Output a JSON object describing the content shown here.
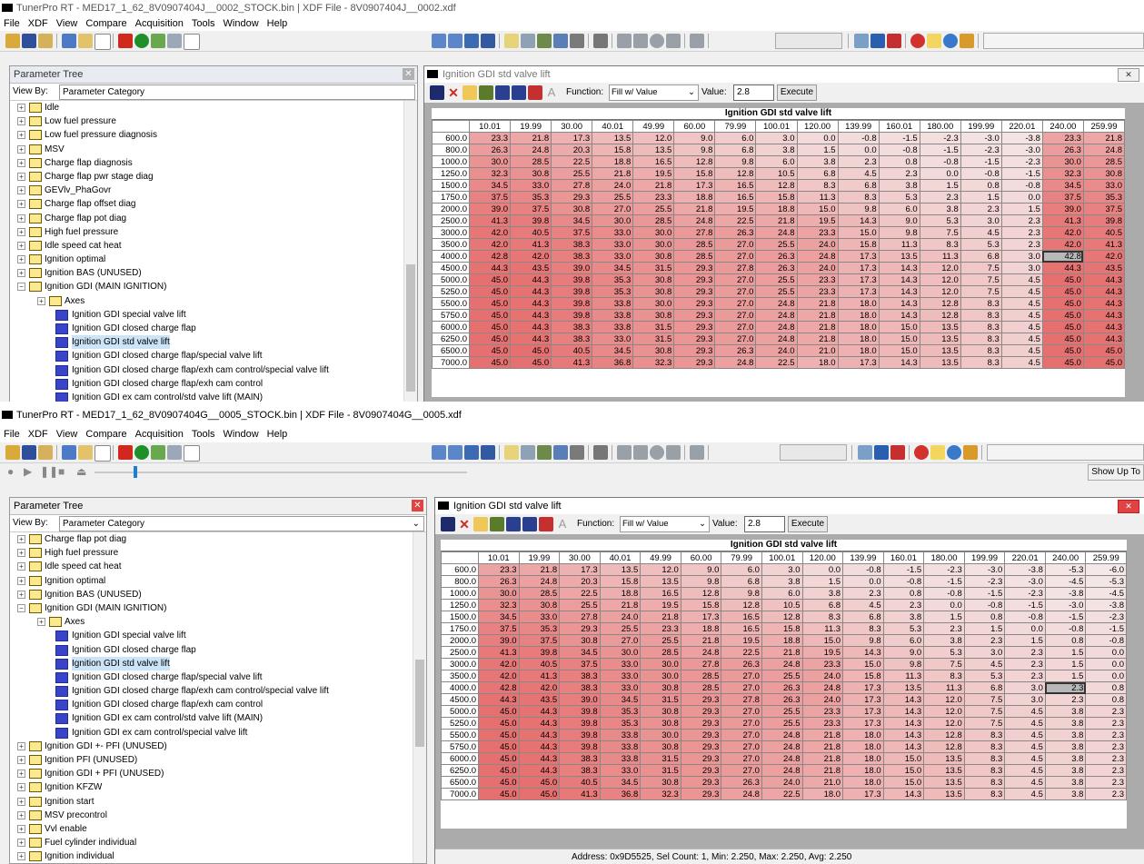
{
  "top": {
    "title": "TunerPro RT - MED17_1_62_8V0907404J__0002_STOCK.bin | XDF File - 8V0907404J__0002.xdf",
    "menu": [
      "File",
      "XDF",
      "View",
      "Compare",
      "Acquisition",
      "Tools",
      "Window",
      "Help"
    ],
    "tree_header": "Parameter Tree",
    "view_by_label": "View By:",
    "view_by_value": "Parameter Category",
    "tree": [
      {
        "label": "Idle",
        "kind": "folder",
        "indent": 0
      },
      {
        "label": "Low fuel pressure",
        "kind": "folder",
        "indent": 0
      },
      {
        "label": "Low fuel pressure diagnosis",
        "kind": "folder",
        "indent": 0
      },
      {
        "label": "MSV",
        "kind": "folder",
        "indent": 0
      },
      {
        "label": "Charge flap diagnosis",
        "kind": "folder",
        "indent": 0
      },
      {
        "label": "Charge flap pwr stage diag",
        "kind": "folder",
        "indent": 0
      },
      {
        "label": "GEVlv_PhaGovr",
        "kind": "folder",
        "indent": 0
      },
      {
        "label": "Charge flap offset diag",
        "kind": "folder",
        "indent": 0
      },
      {
        "label": "Charge flap pot diag",
        "kind": "folder",
        "indent": 0
      },
      {
        "label": "High fuel pressure",
        "kind": "folder",
        "indent": 0
      },
      {
        "label": "Idle speed cat heat",
        "kind": "folder",
        "indent": 0
      },
      {
        "label": "Ignition optimal",
        "kind": "folder",
        "indent": 0
      },
      {
        "label": "Ignition BAS (UNUSED)",
        "kind": "folder",
        "indent": 0
      },
      {
        "label": "Ignition GDI (MAIN IGNITION)",
        "kind": "open",
        "indent": 0
      },
      {
        "label": "Axes",
        "kind": "folder",
        "indent": 1
      },
      {
        "label": "Ignition GDI special valve lift",
        "kind": "table",
        "indent": 1
      },
      {
        "label": "Ignition GDI closed charge flap",
        "kind": "table",
        "indent": 1
      },
      {
        "label": "Ignition GDI std valve lift",
        "kind": "table",
        "indent": 1,
        "selected": true
      },
      {
        "label": "Ignition GDI closed charge flap/special valve lift",
        "kind": "table",
        "indent": 1
      },
      {
        "label": "Ignition GDI closed charge flap/exh cam control/special valve lift",
        "kind": "table",
        "indent": 1
      },
      {
        "label": "Ignition GDI closed charge flap/exh cam control",
        "kind": "table",
        "indent": 1
      },
      {
        "label": "Ignition GDI ex cam control/std valve lift (MAIN)",
        "kind": "table",
        "indent": 1
      }
    ],
    "table_window_title": "Ignition GDI std valve lift",
    "function_label": "Function:",
    "function_value": "Fill w/ Value",
    "value_label": "Value:",
    "value_input": "2.8",
    "execute_label": "Execute",
    "table_title": "Ignition GDI std valve lift",
    "col_headers": [
      "10.01",
      "19.99",
      "30.00",
      "40.01",
      "49.99",
      "60.00",
      "79.99",
      "100.01",
      "120.00",
      "139.99",
      "160.01",
      "180.00",
      "199.99",
      "220.01",
      "240.00",
      "259.99"
    ],
    "row_headers": [
      "600.0",
      "800.0",
      "1000.0",
      "1250.0",
      "1500.0",
      "1750.0",
      "2000.0",
      "2500.0",
      "3000.0",
      "3500.0",
      "4000.0",
      "4500.0",
      "5000.0",
      "5250.0",
      "5500.0",
      "5750.0",
      "6000.0",
      "6250.0",
      "6500.0",
      "7000.0"
    ],
    "cells": [
      [
        "23.3",
        "21.8",
        "17.3",
        "13.5",
        "12.0",
        "9.0",
        "6.0",
        "3.0",
        "0.0",
        "-0.8",
        "-1.5",
        "-2.3",
        "-3.0",
        "-3.8",
        "23.3",
        "21.8"
      ],
      [
        "26.3",
        "24.8",
        "20.3",
        "15.8",
        "13.5",
        "9.8",
        "6.8",
        "3.8",
        "1.5",
        "0.0",
        "-0.8",
        "-1.5",
        "-2.3",
        "-3.0",
        "26.3",
        "24.8"
      ],
      [
        "30.0",
        "28.5",
        "22.5",
        "18.8",
        "16.5",
        "12.8",
        "9.8",
        "6.0",
        "3.8",
        "2.3",
        "0.8",
        "-0.8",
        "-1.5",
        "-2.3",
        "30.0",
        "28.5"
      ],
      [
        "32.3",
        "30.8",
        "25.5",
        "21.8",
        "19.5",
        "15.8",
        "12.8",
        "10.5",
        "6.8",
        "4.5",
        "2.3",
        "0.0",
        "-0.8",
        "-1.5",
        "32.3",
        "30.8"
      ],
      [
        "34.5",
        "33.0",
        "27.8",
        "24.0",
        "21.8",
        "17.3",
        "16.5",
        "12.8",
        "8.3",
        "6.8",
        "3.8",
        "1.5",
        "0.8",
        "-0.8",
        "34.5",
        "33.0"
      ],
      [
        "37.5",
        "35.3",
        "29.3",
        "25.5",
        "23.3",
        "18.8",
        "16.5",
        "15.8",
        "11.3",
        "8.3",
        "5.3",
        "2.3",
        "1.5",
        "0.0",
        "37.5",
        "35.3"
      ],
      [
        "39.0",
        "37.5",
        "30.8",
        "27.0",
        "25.5",
        "21.8",
        "19.5",
        "18.8",
        "15.0",
        "9.8",
        "6.0",
        "3.8",
        "2.3",
        "1.5",
        "39.0",
        "37.5"
      ],
      [
        "41.3",
        "39.8",
        "34.5",
        "30.0",
        "28.5",
        "24.8",
        "22.5",
        "21.8",
        "19.5",
        "14.3",
        "9.0",
        "5.3",
        "3.0",
        "2.3",
        "41.3",
        "39.8"
      ],
      [
        "42.0",
        "40.5",
        "37.5",
        "33.0",
        "30.0",
        "27.8",
        "26.3",
        "24.8",
        "23.3",
        "15.0",
        "9.8",
        "7.5",
        "4.5",
        "2.3",
        "42.0",
        "40.5"
      ],
      [
        "42.0",
        "41.3",
        "38.3",
        "33.0",
        "30.0",
        "28.5",
        "27.0",
        "25.5",
        "24.0",
        "15.8",
        "11.3",
        "8.3",
        "5.3",
        "2.3",
        "42.0",
        "41.3"
      ],
      [
        "42.8",
        "42.0",
        "38.3",
        "33.0",
        "30.8",
        "28.5",
        "27.0",
        "26.3",
        "24.8",
        "17.3",
        "13.5",
        "11.3",
        "6.8",
        "3.0",
        "42.8",
        "42.0"
      ],
      [
        "44.3",
        "43.5",
        "39.0",
        "34.5",
        "31.5",
        "29.3",
        "27.8",
        "26.3",
        "24.0",
        "17.3",
        "14.3",
        "12.0",
        "7.5",
        "3.0",
        "44.3",
        "43.5"
      ],
      [
        "45.0",
        "44.3",
        "39.8",
        "35.3",
        "30.8",
        "29.3",
        "27.0",
        "25.5",
        "23.3",
        "17.3",
        "14.3",
        "12.0",
        "7.5",
        "4.5",
        "45.0",
        "44.3"
      ],
      [
        "45.0",
        "44.3",
        "39.8",
        "35.3",
        "30.8",
        "29.3",
        "27.0",
        "25.5",
        "23.3",
        "17.3",
        "14.3",
        "12.0",
        "7.5",
        "4.5",
        "45.0",
        "44.3"
      ],
      [
        "45.0",
        "44.3",
        "39.8",
        "33.8",
        "30.0",
        "29.3",
        "27.0",
        "24.8",
        "21.8",
        "18.0",
        "14.3",
        "12.8",
        "8.3",
        "4.5",
        "45.0",
        "44.3"
      ],
      [
        "45.0",
        "44.3",
        "39.8",
        "33.8",
        "30.8",
        "29.3",
        "27.0",
        "24.8",
        "21.8",
        "18.0",
        "14.3",
        "12.8",
        "8.3",
        "4.5",
        "45.0",
        "44.3"
      ],
      [
        "45.0",
        "44.3",
        "38.3",
        "33.8",
        "31.5",
        "29.3",
        "27.0",
        "24.8",
        "21.8",
        "18.0",
        "15.0",
        "13.5",
        "8.3",
        "4.5",
        "45.0",
        "44.3"
      ],
      [
        "45.0",
        "44.3",
        "38.3",
        "33.0",
        "31.5",
        "29.3",
        "27.0",
        "24.8",
        "21.8",
        "18.0",
        "15.0",
        "13.5",
        "8.3",
        "4.5",
        "45.0",
        "44.3"
      ],
      [
        "45.0",
        "45.0",
        "40.5",
        "34.5",
        "30.8",
        "29.3",
        "26.3",
        "24.0",
        "21.0",
        "18.0",
        "15.0",
        "13.5",
        "8.3",
        "4.5",
        "45.0",
        "45.0"
      ],
      [
        "45.0",
        "45.0",
        "41.3",
        "36.8",
        "32.3",
        "29.3",
        "24.8",
        "22.5",
        "18.0",
        "17.3",
        "14.3",
        "13.5",
        "8.3",
        "4.5",
        "45.0",
        "45.0"
      ]
    ],
    "selected_cell": [
      10,
      14
    ]
  },
  "bottom": {
    "title": "TunerPro RT - MED17_1_62_8V0907404G__0005_STOCK.bin | XDF File - 8V0907404G__0005.xdf",
    "menu": [
      "File",
      "XDF",
      "View",
      "Compare",
      "Acquisition",
      "Tools",
      "Window",
      "Help"
    ],
    "show_up_label": "Show Up To",
    "tree_header": "Parameter Tree",
    "view_by_label": "View By:",
    "view_by_value": "Parameter Category",
    "tree": [
      {
        "label": "Charge flap pot diag",
        "kind": "folder",
        "indent": 0
      },
      {
        "label": "High fuel pressure",
        "kind": "folder",
        "indent": 0
      },
      {
        "label": "Idle speed cat heat",
        "kind": "folder",
        "indent": 0
      },
      {
        "label": "Ignition optimal",
        "kind": "folder",
        "indent": 0
      },
      {
        "label": "Ignition BAS (UNUSED)",
        "kind": "folder",
        "indent": 0
      },
      {
        "label": "Ignition GDI (MAIN IGNITION)",
        "kind": "open",
        "indent": 0
      },
      {
        "label": "Axes",
        "kind": "folder",
        "indent": 1
      },
      {
        "label": "Ignition GDI special valve lift",
        "kind": "table",
        "indent": 1
      },
      {
        "label": "Ignition GDI closed charge flap",
        "kind": "table",
        "indent": 1
      },
      {
        "label": "Ignition GDI std valve lift",
        "kind": "table",
        "indent": 1,
        "selected": true
      },
      {
        "label": "Ignition GDI closed charge flap/special valve lift",
        "kind": "table",
        "indent": 1
      },
      {
        "label": "Ignition GDI closed charge flap/exh cam control/special valve lift",
        "kind": "table",
        "indent": 1
      },
      {
        "label": "Ignition GDI closed charge flap/exh cam control",
        "kind": "table",
        "indent": 1
      },
      {
        "label": "Ignition GDI ex cam control/std valve lift (MAIN)",
        "kind": "table",
        "indent": 1
      },
      {
        "label": "Ignition GDI ex cam control/special valve lift",
        "kind": "table",
        "indent": 1
      },
      {
        "label": "Ignition GDI +- PFI (UNUSED)",
        "kind": "folder",
        "indent": 0
      },
      {
        "label": "Ignition PFI (UNUSED)",
        "kind": "folder",
        "indent": 0
      },
      {
        "label": "Ignition GDI + PFI (UNUSED)",
        "kind": "folder",
        "indent": 0
      },
      {
        "label": "Ignition KFZW",
        "kind": "folder",
        "indent": 0
      },
      {
        "label": "Ignition start",
        "kind": "folder",
        "indent": 0
      },
      {
        "label": "MSV precontrol",
        "kind": "folder",
        "indent": 0
      },
      {
        "label": "Vvl enable",
        "kind": "folder",
        "indent": 0
      },
      {
        "label": "Fuel cylinder individual",
        "kind": "folder",
        "indent": 0
      },
      {
        "label": "Ignition individual",
        "kind": "folder",
        "indent": 0
      }
    ],
    "table_window_title": "Ignition GDI std valve lift",
    "function_label": "Function:",
    "function_value": "Fill w/ Value",
    "value_label": "Value:",
    "value_input": "2.8",
    "execute_label": "Execute",
    "table_title": "Ignition GDI std valve lift",
    "col_headers": [
      "10.01",
      "19.99",
      "30.00",
      "40.01",
      "49.99",
      "60.00",
      "79.99",
      "100.01",
      "120.00",
      "139.99",
      "160.01",
      "180.00",
      "199.99",
      "220.01",
      "240.00",
      "259.99"
    ],
    "row_headers": [
      "600.0",
      "800.0",
      "1000.0",
      "1250.0",
      "1500.0",
      "1750.0",
      "2000.0",
      "2500.0",
      "3000.0",
      "3500.0",
      "4000.0",
      "4500.0",
      "5000.0",
      "5250.0",
      "5500.0",
      "5750.0",
      "6000.0",
      "6250.0",
      "6500.0",
      "7000.0"
    ],
    "cells": [
      [
        "23.3",
        "21.8",
        "17.3",
        "13.5",
        "12.0",
        "9.0",
        "6.0",
        "3.0",
        "0.0",
        "-0.8",
        "-1.5",
        "-2.3",
        "-3.0",
        "-3.8",
        "-5.3",
        "-6.0"
      ],
      [
        "26.3",
        "24.8",
        "20.3",
        "15.8",
        "13.5",
        "9.8",
        "6.8",
        "3.8",
        "1.5",
        "0.0",
        "-0.8",
        "-1.5",
        "-2.3",
        "-3.0",
        "-4.5",
        "-5.3"
      ],
      [
        "30.0",
        "28.5",
        "22.5",
        "18.8",
        "16.5",
        "12.8",
        "9.8",
        "6.0",
        "3.8",
        "2.3",
        "0.8",
        "-0.8",
        "-1.5",
        "-2.3",
        "-3.8",
        "-4.5"
      ],
      [
        "32.3",
        "30.8",
        "25.5",
        "21.8",
        "19.5",
        "15.8",
        "12.8",
        "10.5",
        "6.8",
        "4.5",
        "2.3",
        "0.0",
        "-0.8",
        "-1.5",
        "-3.0",
        "-3.8"
      ],
      [
        "34.5",
        "33.0",
        "27.8",
        "24.0",
        "21.8",
        "17.3",
        "16.5",
        "12.8",
        "8.3",
        "6.8",
        "3.8",
        "1.5",
        "0.8",
        "-0.8",
        "-1.5",
        "-2.3"
      ],
      [
        "37.5",
        "35.3",
        "29.3",
        "25.5",
        "23.3",
        "18.8",
        "16.5",
        "15.8",
        "11.3",
        "8.3",
        "5.3",
        "2.3",
        "1.5",
        "0.0",
        "-0.8",
        "-1.5"
      ],
      [
        "39.0",
        "37.5",
        "30.8",
        "27.0",
        "25.5",
        "21.8",
        "19.5",
        "18.8",
        "15.0",
        "9.8",
        "6.0",
        "3.8",
        "2.3",
        "1.5",
        "0.8",
        "-0.8"
      ],
      [
        "41.3",
        "39.8",
        "34.5",
        "30.0",
        "28.5",
        "24.8",
        "22.5",
        "21.8",
        "19.5",
        "14.3",
        "9.0",
        "5.3",
        "3.0",
        "2.3",
        "1.5",
        "0.0"
      ],
      [
        "42.0",
        "40.5",
        "37.5",
        "33.0",
        "30.0",
        "27.8",
        "26.3",
        "24.8",
        "23.3",
        "15.0",
        "9.8",
        "7.5",
        "4.5",
        "2.3",
        "1.5",
        "0.0"
      ],
      [
        "42.0",
        "41.3",
        "38.3",
        "33.0",
        "30.0",
        "28.5",
        "27.0",
        "25.5",
        "24.0",
        "15.8",
        "11.3",
        "8.3",
        "5.3",
        "2.3",
        "1.5",
        "0.0"
      ],
      [
        "42.8",
        "42.0",
        "38.3",
        "33.0",
        "30.8",
        "28.5",
        "27.0",
        "26.3",
        "24.8",
        "17.3",
        "13.5",
        "11.3",
        "6.8",
        "3.0",
        "2.3",
        "0.8"
      ],
      [
        "44.3",
        "43.5",
        "39.0",
        "34.5",
        "31.5",
        "29.3",
        "27.8",
        "26.3",
        "24.0",
        "17.3",
        "14.3",
        "12.0",
        "7.5",
        "3.0",
        "2.3",
        "0.8"
      ],
      [
        "45.0",
        "44.3",
        "39.8",
        "35.3",
        "30.8",
        "29.3",
        "27.0",
        "25.5",
        "23.3",
        "17.3",
        "14.3",
        "12.0",
        "7.5",
        "4.5",
        "3.8",
        "2.3"
      ],
      [
        "45.0",
        "44.3",
        "39.8",
        "35.3",
        "30.8",
        "29.3",
        "27.0",
        "25.5",
        "23.3",
        "17.3",
        "14.3",
        "12.0",
        "7.5",
        "4.5",
        "3.8",
        "2.3"
      ],
      [
        "45.0",
        "44.3",
        "39.8",
        "33.8",
        "30.0",
        "29.3",
        "27.0",
        "24.8",
        "21.8",
        "18.0",
        "14.3",
        "12.8",
        "8.3",
        "4.5",
        "3.8",
        "2.3"
      ],
      [
        "45.0",
        "44.3",
        "39.8",
        "33.8",
        "30.8",
        "29.3",
        "27.0",
        "24.8",
        "21.8",
        "18.0",
        "14.3",
        "12.8",
        "8.3",
        "4.5",
        "3.8",
        "2.3"
      ],
      [
        "45.0",
        "44.3",
        "38.3",
        "33.8",
        "31.5",
        "29.3",
        "27.0",
        "24.8",
        "21.8",
        "18.0",
        "15.0",
        "13.5",
        "8.3",
        "4.5",
        "3.8",
        "2.3"
      ],
      [
        "45.0",
        "44.3",
        "38.3",
        "33.0",
        "31.5",
        "29.3",
        "27.0",
        "24.8",
        "21.8",
        "18.0",
        "15.0",
        "13.5",
        "8.3",
        "4.5",
        "3.8",
        "2.3"
      ],
      [
        "45.0",
        "45.0",
        "40.5",
        "34.5",
        "30.8",
        "29.3",
        "26.3",
        "24.0",
        "21.0",
        "18.0",
        "15.0",
        "13.5",
        "8.3",
        "4.5",
        "3.8",
        "2.3"
      ],
      [
        "45.0",
        "45.0",
        "41.3",
        "36.8",
        "32.3",
        "29.3",
        "24.8",
        "22.5",
        "18.0",
        "17.3",
        "14.3",
        "13.5",
        "8.3",
        "4.5",
        "3.8",
        "2.3"
      ]
    ],
    "selected_cell": [
      10,
      14
    ],
    "status_text": "Address: 0x9D5525, Sel Count: 1, Min: 2.250, Max: 2.250, Avg: 2.250"
  },
  "colors": {
    "accent_close": "#e81123",
    "cell_low": "#f7eaea",
    "cell_high": "#e87878",
    "tree_icon": "#3a44c8",
    "folder": "#fce98f"
  }
}
